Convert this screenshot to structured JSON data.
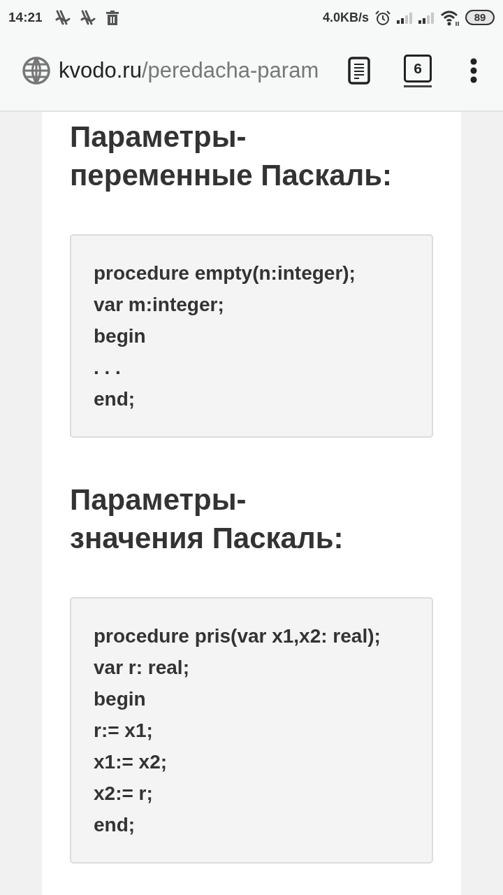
{
  "status_bar": {
    "time": "14:21",
    "network_speed": "4.0KB/s",
    "battery": "89"
  },
  "browser_toolbar": {
    "url_host": "kvodo.ru",
    "url_path": "/peredacha-param",
    "tab_count": "6"
  },
  "article": {
    "sections": [
      {
        "heading": "Параметры-\nпеременные Паскаль:",
        "code_lines": [
          "procedure empty(n:integer);",
          "var m:integer;",
          "begin",
          ". . .",
          "end;"
        ]
      },
      {
        "heading": "Параметры-\nзначения Паскаль:",
        "code_lines": [
          "procedure pris(var x1,x2: real);",
          "var r: real;",
          "begin",
          "r:= x1;",
          "x1:= x2;",
          "x2:= r;",
          "end;"
        ]
      }
    ]
  }
}
